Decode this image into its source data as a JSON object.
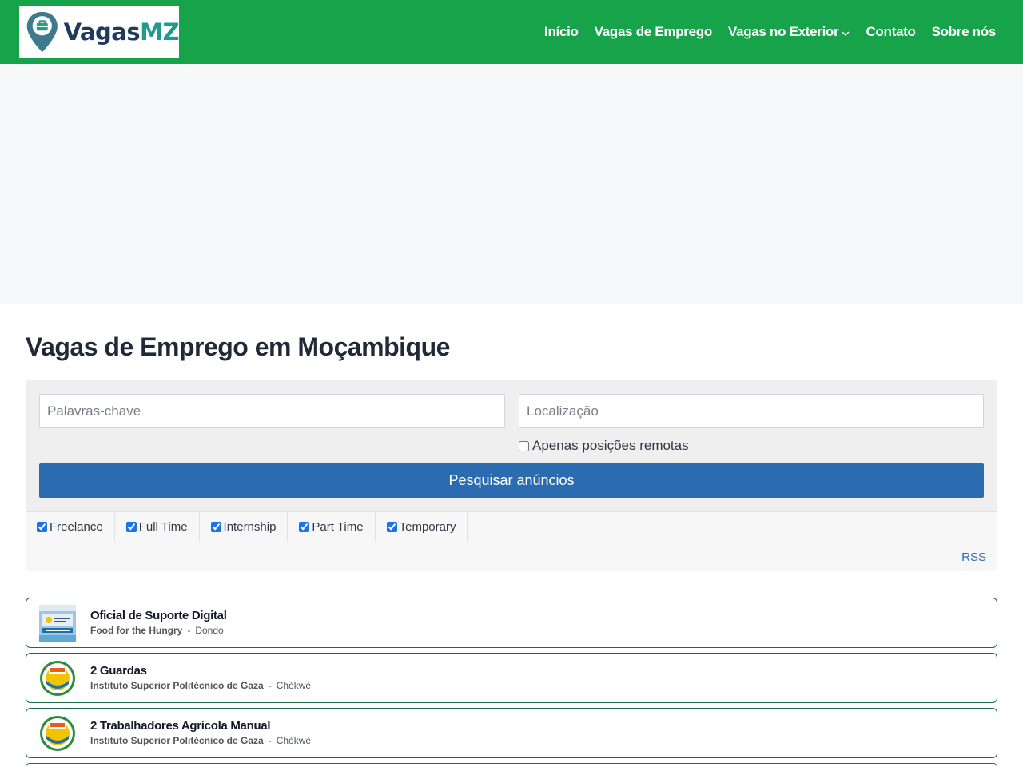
{
  "header": {
    "logo": {
      "part1": "Vagas",
      "part2": "MZ"
    },
    "nav": [
      {
        "label": "Início"
      },
      {
        "label": "Vagas de Emprego"
      },
      {
        "label": "Vagas no Exterior"
      },
      {
        "label": "Contato"
      },
      {
        "label": "Sobre nós"
      }
    ]
  },
  "page": {
    "title": "Vagas de Emprego em Moçambique"
  },
  "search": {
    "keywords_placeholder": "Palavras-chave",
    "location_placeholder": "Localização",
    "remote_label": "Apenas posições remotas",
    "button_label": "Pesquisar anúncios"
  },
  "filters": [
    {
      "label": "Freelance",
      "checked": true
    },
    {
      "label": "Full Time",
      "checked": true
    },
    {
      "label": "Internship",
      "checked": true
    },
    {
      "label": "Part Time",
      "checked": true
    },
    {
      "label": "Temporary",
      "checked": true
    }
  ],
  "rss_label": "RSS",
  "jobs": [
    {
      "title": "Oficial de Suporte Digital",
      "company": "Food for the Hungry",
      "location": "Dondo"
    },
    {
      "title": "2 Guardas",
      "company": "Instituto Superior Politécnico de Gaza",
      "location": "Chókwè"
    },
    {
      "title": "2 Trabalhadores Agrícola Manual",
      "company": "Instituto Superior Politécnico de Gaza",
      "location": "Chókwè"
    }
  ],
  "colors": {
    "header": "#16a34a",
    "button": "#2b6cb0",
    "job_border": "#1e6b4a"
  }
}
